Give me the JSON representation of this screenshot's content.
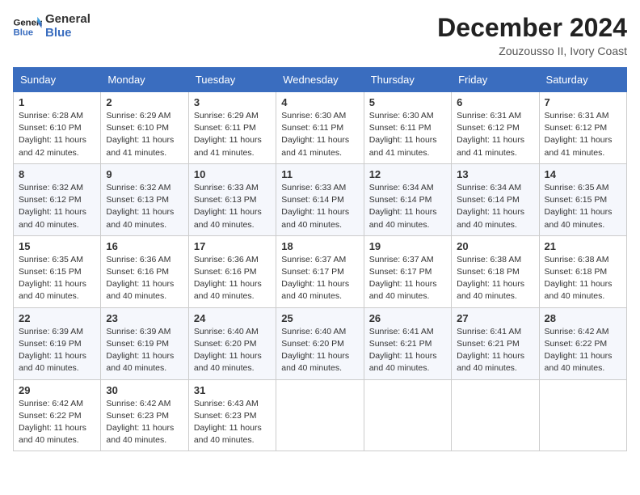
{
  "header": {
    "logo_line1": "General",
    "logo_line2": "Blue",
    "month_year": "December 2024",
    "location": "Zouzousso II, Ivory Coast"
  },
  "days_of_week": [
    "Sunday",
    "Monday",
    "Tuesday",
    "Wednesday",
    "Thursday",
    "Friday",
    "Saturday"
  ],
  "weeks": [
    [
      {
        "day": 1,
        "sunrise": "6:28 AM",
        "sunset": "6:10 PM",
        "daylight": "11 hours and 42 minutes."
      },
      {
        "day": 2,
        "sunrise": "6:29 AM",
        "sunset": "6:10 PM",
        "daylight": "11 hours and 41 minutes."
      },
      {
        "day": 3,
        "sunrise": "6:29 AM",
        "sunset": "6:11 PM",
        "daylight": "11 hours and 41 minutes."
      },
      {
        "day": 4,
        "sunrise": "6:30 AM",
        "sunset": "6:11 PM",
        "daylight": "11 hours and 41 minutes."
      },
      {
        "day": 5,
        "sunrise": "6:30 AM",
        "sunset": "6:11 PM",
        "daylight": "11 hours and 41 minutes."
      },
      {
        "day": 6,
        "sunrise": "6:31 AM",
        "sunset": "6:12 PM",
        "daylight": "11 hours and 41 minutes."
      },
      {
        "day": 7,
        "sunrise": "6:31 AM",
        "sunset": "6:12 PM",
        "daylight": "11 hours and 41 minutes."
      }
    ],
    [
      {
        "day": 8,
        "sunrise": "6:32 AM",
        "sunset": "6:12 PM",
        "daylight": "11 hours and 40 minutes."
      },
      {
        "day": 9,
        "sunrise": "6:32 AM",
        "sunset": "6:13 PM",
        "daylight": "11 hours and 40 minutes."
      },
      {
        "day": 10,
        "sunrise": "6:33 AM",
        "sunset": "6:13 PM",
        "daylight": "11 hours and 40 minutes."
      },
      {
        "day": 11,
        "sunrise": "6:33 AM",
        "sunset": "6:14 PM",
        "daylight": "11 hours and 40 minutes."
      },
      {
        "day": 12,
        "sunrise": "6:34 AM",
        "sunset": "6:14 PM",
        "daylight": "11 hours and 40 minutes."
      },
      {
        "day": 13,
        "sunrise": "6:34 AM",
        "sunset": "6:14 PM",
        "daylight": "11 hours and 40 minutes."
      },
      {
        "day": 14,
        "sunrise": "6:35 AM",
        "sunset": "6:15 PM",
        "daylight": "11 hours and 40 minutes."
      }
    ],
    [
      {
        "day": 15,
        "sunrise": "6:35 AM",
        "sunset": "6:15 PM",
        "daylight": "11 hours and 40 minutes."
      },
      {
        "day": 16,
        "sunrise": "6:36 AM",
        "sunset": "6:16 PM",
        "daylight": "11 hours and 40 minutes."
      },
      {
        "day": 17,
        "sunrise": "6:36 AM",
        "sunset": "6:16 PM",
        "daylight": "11 hours and 40 minutes."
      },
      {
        "day": 18,
        "sunrise": "6:37 AM",
        "sunset": "6:17 PM",
        "daylight": "11 hours and 40 minutes."
      },
      {
        "day": 19,
        "sunrise": "6:37 AM",
        "sunset": "6:17 PM",
        "daylight": "11 hours and 40 minutes."
      },
      {
        "day": 20,
        "sunrise": "6:38 AM",
        "sunset": "6:18 PM",
        "daylight": "11 hours and 40 minutes."
      },
      {
        "day": 21,
        "sunrise": "6:38 AM",
        "sunset": "6:18 PM",
        "daylight": "11 hours and 40 minutes."
      }
    ],
    [
      {
        "day": 22,
        "sunrise": "6:39 AM",
        "sunset": "6:19 PM",
        "daylight": "11 hours and 40 minutes."
      },
      {
        "day": 23,
        "sunrise": "6:39 AM",
        "sunset": "6:19 PM",
        "daylight": "11 hours and 40 minutes."
      },
      {
        "day": 24,
        "sunrise": "6:40 AM",
        "sunset": "6:20 PM",
        "daylight": "11 hours and 40 minutes."
      },
      {
        "day": 25,
        "sunrise": "6:40 AM",
        "sunset": "6:20 PM",
        "daylight": "11 hours and 40 minutes."
      },
      {
        "day": 26,
        "sunrise": "6:41 AM",
        "sunset": "6:21 PM",
        "daylight": "11 hours and 40 minutes."
      },
      {
        "day": 27,
        "sunrise": "6:41 AM",
        "sunset": "6:21 PM",
        "daylight": "11 hours and 40 minutes."
      },
      {
        "day": 28,
        "sunrise": "6:42 AM",
        "sunset": "6:22 PM",
        "daylight": "11 hours and 40 minutes."
      }
    ],
    [
      {
        "day": 29,
        "sunrise": "6:42 AM",
        "sunset": "6:22 PM",
        "daylight": "11 hours and 40 minutes."
      },
      {
        "day": 30,
        "sunrise": "6:42 AM",
        "sunset": "6:23 PM",
        "daylight": "11 hours and 40 minutes."
      },
      {
        "day": 31,
        "sunrise": "6:43 AM",
        "sunset": "6:23 PM",
        "daylight": "11 hours and 40 minutes."
      },
      null,
      null,
      null,
      null
    ]
  ],
  "labels": {
    "sunrise": "Sunrise: ",
    "sunset": "Sunset: ",
    "daylight": "Daylight: "
  }
}
